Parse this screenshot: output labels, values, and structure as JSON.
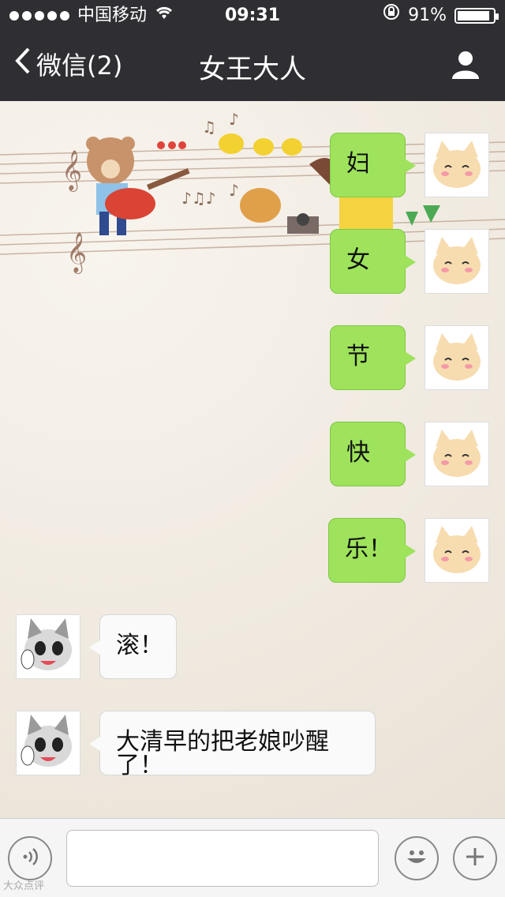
{
  "status_bar": {
    "carrier": "中国移动",
    "time": "09:31",
    "battery": "91%",
    "battery_level": 0.91
  },
  "nav": {
    "back_label": "微信(2)",
    "title": "女王大人"
  },
  "messages": [
    {
      "from": "me",
      "text": "妇"
    },
    {
      "from": "me",
      "text": "女"
    },
    {
      "from": "me",
      "text": "节"
    },
    {
      "from": "me",
      "text": "快"
    },
    {
      "from": "me",
      "text": "乐！"
    },
    {
      "from": "them",
      "text": "滚！"
    },
    {
      "from": "them",
      "text": "大清早的把老娘吵醒了！"
    }
  ],
  "input_bar": {
    "value": "",
    "voice_icon": "voice-icon",
    "emoji_icon": "emoji-icon",
    "plus_icon": "plus-icon"
  },
  "watermark": "大众点评",
  "colors": {
    "header_bg": "#2f2f33",
    "my_bubble": "#9ee35b",
    "their_bubble": "#fafafa"
  }
}
